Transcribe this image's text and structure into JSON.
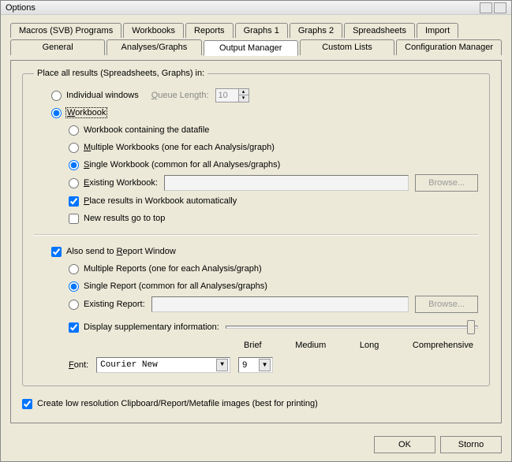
{
  "window": {
    "title": "Options"
  },
  "tabs": {
    "row1": [
      "Macros (SVB) Programs",
      "Workbooks",
      "Reports",
      "Graphs 1",
      "Graphs 2",
      "Spreadsheets",
      "Import"
    ],
    "row2": [
      "General",
      "Analyses/Graphs",
      "Output Manager",
      "Custom Lists",
      "Configuration Manager"
    ],
    "active": "Output Manager"
  },
  "group": {
    "legend": "Place all results (Spreadsheets, Graphs) in:"
  },
  "place": {
    "individual_label": "Individual windows",
    "queue_label": "Queue Length:",
    "queue_value": "10",
    "workbook_label": "Workbook",
    "wb_containing_label": "Workbook containing the datafile",
    "wb_multiple_label": "Multiple Workbooks (one for each Analysis/graph)",
    "wb_single_label": "Single Workbook (common for all Analyses/graphs)",
    "wb_existing_label": "Existing Workbook:",
    "browse_label": "Browse...",
    "place_auto_label": "Place results in Workbook automatically",
    "new_top_label": "New results go to top"
  },
  "report": {
    "also_send_label": "Also send to Report Window",
    "multiple_label": "Multiple Reports (one for each Analysis/graph)",
    "single_label": "Single Report (common for all Analyses/graphs)",
    "existing_label": "Existing Report:",
    "browse_label": "Browse...",
    "display_supp_label": "Display supplementary information:",
    "ticks": [
      "Brief",
      "Medium",
      "Long",
      "Comprehensive"
    ],
    "font_label": "Font:",
    "font_value": "Courier New",
    "size_value": "9"
  },
  "lowres": {
    "label": "Create low resolution Clipboard/Report/Metafile images (best for printing)"
  },
  "buttons": {
    "ok": "OK",
    "cancel": "Storno"
  }
}
